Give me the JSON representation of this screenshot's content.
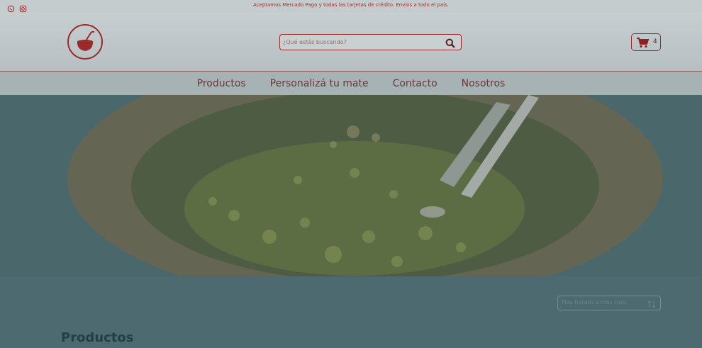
{
  "topbar": {
    "promo": "Aceptamos Mercado Pago y todas las tarjetas de crédito. Envíos a todo el país.",
    "icons": [
      "whatsapp-icon",
      "instagram-icon"
    ]
  },
  "header": {
    "logo_icon": "mate-cup-icon",
    "search": {
      "placeholder": "¿Qué estás buscando?",
      "value": ""
    },
    "cart": {
      "count": "4",
      "icon": "cart-icon"
    }
  },
  "nav": {
    "items": [
      {
        "label": "Productos"
      },
      {
        "label": "Personalizá tu mate"
      },
      {
        "label": "Contacto"
      },
      {
        "label": "Nosotros"
      }
    ]
  },
  "hero": {
    "image": "mate-with-yerba-and-bombilla"
  },
  "sort": {
    "label": "Más barato a más caro"
  },
  "products": {
    "title": "Productos"
  },
  "colors": {
    "brand": "#9b2a2a",
    "overlay": "#4d6a70"
  }
}
